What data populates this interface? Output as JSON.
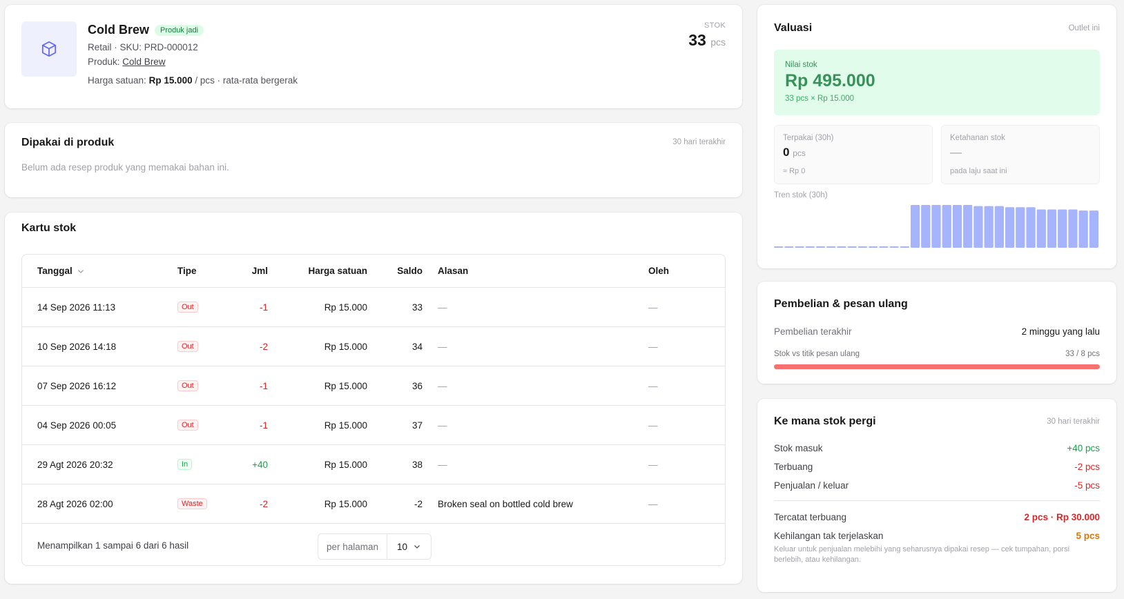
{
  "product": {
    "name": "Cold Brew",
    "badge": "Produk jadi",
    "meta": "Retail · SKU: PRD-000012",
    "product_prefix": "Produk:",
    "product_link": "Cold Brew",
    "price_prefix": "Harga satuan:",
    "price_value": "Rp 15.000",
    "price_suffix": "/ pcs · rata-rata bergerak",
    "stock_label": "STOK",
    "stock_value": "33",
    "stock_unit": "pcs",
    "icon": "cube-icon"
  },
  "used": {
    "title": "Dipakai di produk",
    "period": "30 hari terakhir",
    "empty": "Belum ada resep produk yang memakai bahan ini."
  },
  "stock_card": {
    "title": "Kartu stok",
    "columns": {
      "date": "Tanggal",
      "type": "Tipe",
      "qty": "Jml",
      "price": "Harga satuan",
      "balance": "Saldo",
      "reason": "Alasan",
      "by": "Oleh"
    },
    "rows": [
      {
        "date": "14 Sep 2026 11:13",
        "type": "Out",
        "qty": "-1",
        "price": "Rp 15.000",
        "balance": "33",
        "reason": "—",
        "by": "—"
      },
      {
        "date": "10 Sep 2026 14:18",
        "type": "Out",
        "qty": "-2",
        "price": "Rp 15.000",
        "balance": "34",
        "reason": "—",
        "by": "—"
      },
      {
        "date": "07 Sep 2026 16:12",
        "type": "Out",
        "qty": "-1",
        "price": "Rp 15.000",
        "balance": "36",
        "reason": "—",
        "by": "—"
      },
      {
        "date": "04 Sep 2026 00:05",
        "type": "Out",
        "qty": "-1",
        "price": "Rp 15.000",
        "balance": "37",
        "reason": "—",
        "by": "—"
      },
      {
        "date": "29 Agt 2026 20:32",
        "type": "In",
        "qty": "+40",
        "price": "Rp 15.000",
        "balance": "38",
        "reason": "—",
        "by": "—"
      },
      {
        "date": "28 Agt 2026 02:00",
        "type": "Waste",
        "qty": "-2",
        "price": "Rp 15.000",
        "balance": "-2",
        "reason": "Broken seal on bottled cold brew",
        "by": "—"
      }
    ],
    "footer": "Menampilkan 1 sampai 6 dari 6 hasil",
    "per_page_label": "per halaman",
    "per_page_value": "10"
  },
  "valuation": {
    "title": "Valuasi",
    "scope": "Outlet ini",
    "stock_value_label": "Nilai stok",
    "stock_value": "Rp 495.000",
    "stock_value_formula": "33 pcs × Rp 15.000",
    "used_label": "Terpakai (30h)",
    "used_value": "0",
    "used_unit": "pcs",
    "used_money": "≈ Rp 0",
    "endurance_label": "Ketahanan stok",
    "endurance_value": "—",
    "endurance_note": "pada laju saat ini",
    "trend_label": "Tren stok (30h)",
    "trend": [
      0,
      0,
      0,
      0,
      0,
      0,
      0,
      0,
      0,
      0,
      0,
      0,
      0,
      38,
      38,
      38,
      38,
      38,
      38,
      37,
      37,
      37,
      36,
      36,
      36,
      34,
      34,
      34,
      34,
      33,
      33
    ],
    "colors": {
      "trend_bar": "#a5b4fc"
    }
  },
  "purchase": {
    "title": "Pembelian & pesan ulang",
    "last_label": "Pembelian terakhir",
    "last_value": "2 minggu yang lalu",
    "reorder_label": "Stok vs titik pesan ulang",
    "reorder_value": "33 / 8 pcs",
    "reorder_fill": 1.0
  },
  "where": {
    "title": "Ke mana stok pergi",
    "period": "30 hari terakhir",
    "in_label": "Stok masuk",
    "in_value": "+40 pcs",
    "waste_label": "Terbuang",
    "waste_value": "-2 pcs",
    "sales_label": "Penjualan / keluar",
    "sales_value": "-5 pcs",
    "recorded_label": "Tercatat terbuang",
    "recorded_value": "2 pcs · Rp 30.000",
    "unexplained_label": "Kehilangan tak terjelaskan",
    "unexplained_value": "5 pcs",
    "note": "Keluar untuk penjualan melebihi yang seharusnya dipakai resep — cek tumpahan, porsi berlebih, atau kehilangan."
  }
}
